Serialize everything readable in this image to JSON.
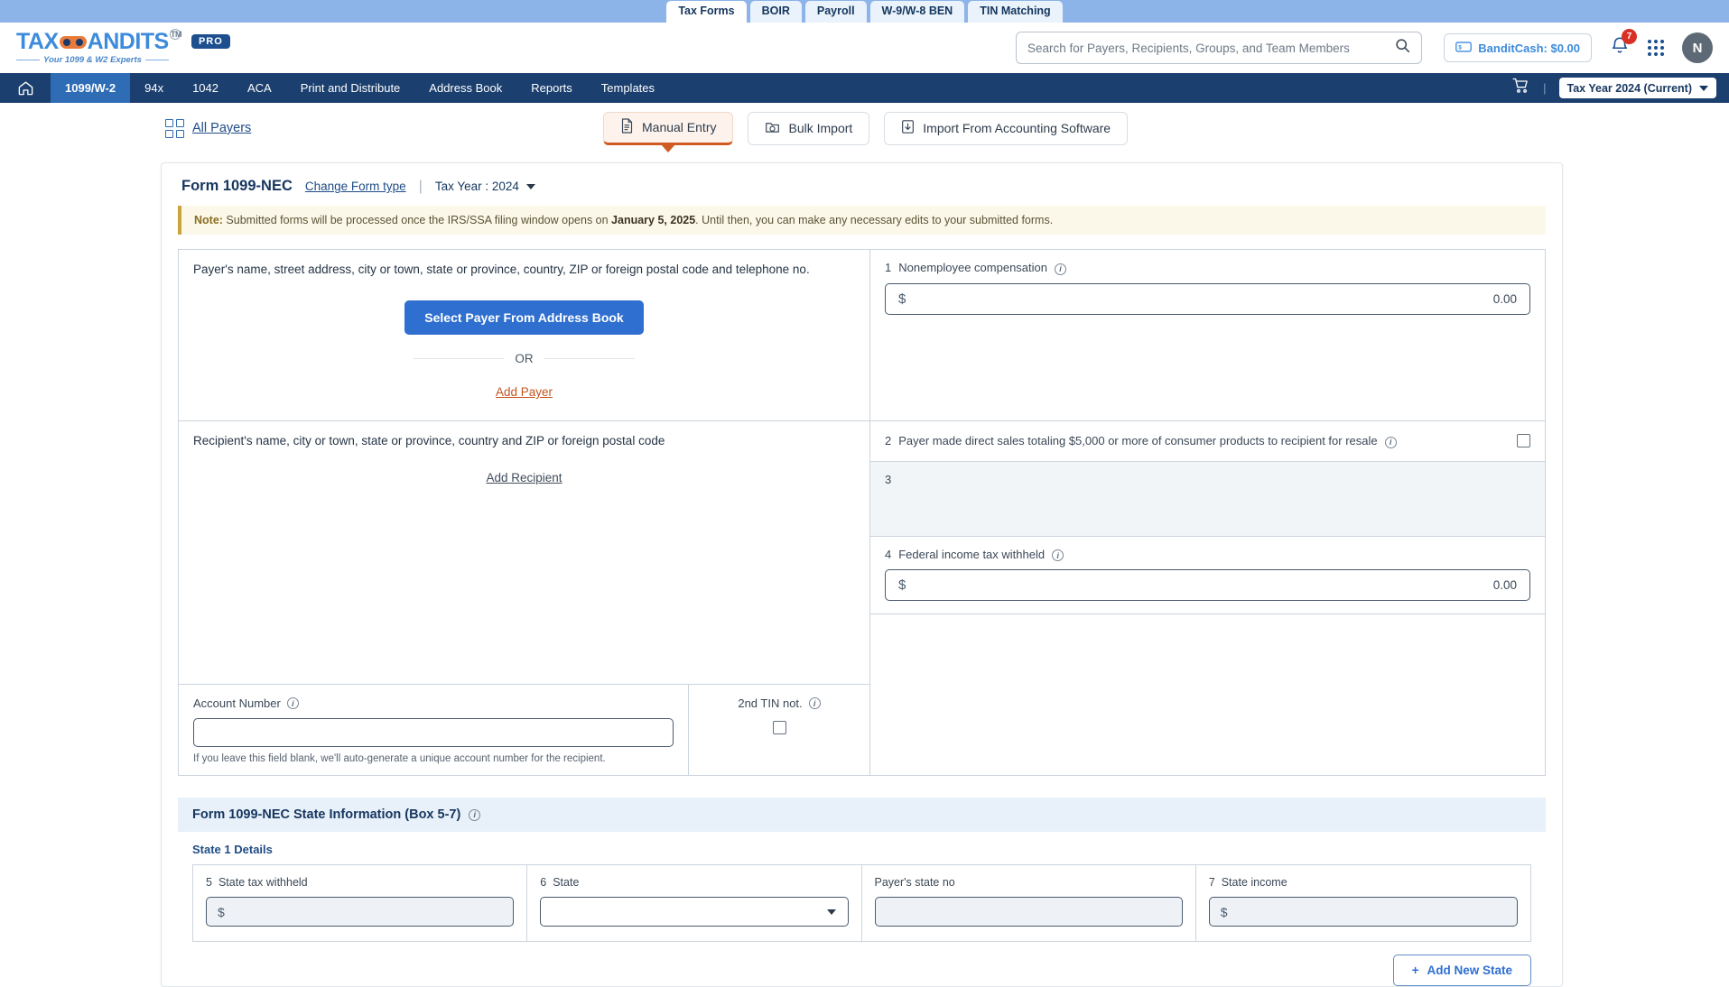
{
  "top_tabs": [
    {
      "label": "Tax Forms",
      "active": true
    },
    {
      "label": "BOIR",
      "active": false
    },
    {
      "label": "Payroll",
      "active": false
    },
    {
      "label": "W-9/W-8 BEN",
      "active": false
    },
    {
      "label": "TIN Matching",
      "active": false
    }
  ],
  "brand": {
    "name_part1": "TAX",
    "name_part2": "ANDITS",
    "trademark": "TM",
    "tagline": "Your 1099 & W2 Experts",
    "pro": "PRO"
  },
  "search": {
    "placeholder": "Search for Payers, Recipients, Groups, and Team Members",
    "value": ""
  },
  "header_right": {
    "bandit_cash": "BanditCash: $0.00",
    "notification_count": "7",
    "avatar_initial": "N"
  },
  "nav": {
    "items": [
      {
        "label": "1099/W-2",
        "active": true
      },
      {
        "label": "94x",
        "active": false
      },
      {
        "label": "1042",
        "active": false
      },
      {
        "label": "ACA",
        "active": false
      },
      {
        "label": "Print and Distribute",
        "active": false
      },
      {
        "label": "Address Book",
        "active": false
      },
      {
        "label": "Reports",
        "active": false
      },
      {
        "label": "Templates",
        "active": false
      }
    ],
    "separator": "|",
    "tax_year": "Tax Year 2024 (Current)"
  },
  "subheader": {
    "all_payers": "All Payers",
    "mode_tabs": [
      {
        "label": "Manual Entry",
        "icon": "document-icon",
        "active": true
      },
      {
        "label": "Bulk Import",
        "icon": "folder-upload-icon",
        "active": false
      },
      {
        "label": "Import From Accounting Software",
        "icon": "download-box-icon",
        "active": false
      }
    ]
  },
  "form": {
    "title": "Form 1099-NEC",
    "change_form_link": "Change Form type",
    "separator": "|",
    "tax_year_label": "Tax Year : 2024",
    "note": {
      "prefix": "Note:",
      "text_before": " Submitted forms will be processed once the IRS/SSA filing window opens on ",
      "bold_date": "January 5, 2025",
      "text_after": ". Until then, you can make any necessary edits to your submitted forms."
    },
    "payer": {
      "label": "Payer's name, street address, city or town, state or province, country, ZIP or foreign postal code and telephone no.",
      "select_button": "Select Payer From Address Book",
      "or": "OR",
      "add_link": "Add Payer"
    },
    "recipient": {
      "label": "Recipient's name, city or town, state or province, country and ZIP or foreign postal code",
      "add_link": "Add Recipient"
    },
    "account_number": {
      "label": "Account Number",
      "value": "",
      "hint": "If you leave this field blank, we'll auto-generate a unique account number for the recipient."
    },
    "second_tin": {
      "label": "2nd TIN not.",
      "checked": false
    },
    "boxes": [
      {
        "num": "1",
        "label": "Nonemployee compensation",
        "dollar": "$",
        "value": "0.00",
        "has_info": true
      },
      {
        "num": "2",
        "label": "Payer made direct sales totaling $5,000 or more of consumer products to recipient for resale",
        "has_info": true,
        "checked": false
      },
      {
        "num": "3",
        "label": "",
        "has_info": false
      },
      {
        "num": "4",
        "label": "Federal income tax withheld",
        "dollar": "$",
        "value": "0.00",
        "has_info": true
      }
    ]
  },
  "state_section": {
    "heading": "Form 1099-NEC  State Information  (Box 5-7)",
    "subheading": "State 1 Details",
    "fields": [
      {
        "num": "5",
        "label": "State tax withheld",
        "type": "money",
        "dollar": "$",
        "value": ""
      },
      {
        "num": "6",
        "label": "State",
        "type": "select",
        "value": ""
      },
      {
        "num": "",
        "label": "Payer's state no",
        "type": "text",
        "value": ""
      },
      {
        "num": "7",
        "label": "State income",
        "type": "money",
        "dollar": "$",
        "value": ""
      }
    ],
    "add_button": "Add New State",
    "add_button_icon": "plus-icon"
  },
  "colors": {
    "nav_bg": "#1b3f6e",
    "nav_active": "#2e6cb5",
    "brand_blue": "#3d8bdb",
    "accent_orange": "#cf5a22",
    "primary_button": "#2f6fd0",
    "note_bg": "#fcf8e9",
    "badge_red": "#d93025",
    "state_head_bg": "#e8f0fa"
  }
}
